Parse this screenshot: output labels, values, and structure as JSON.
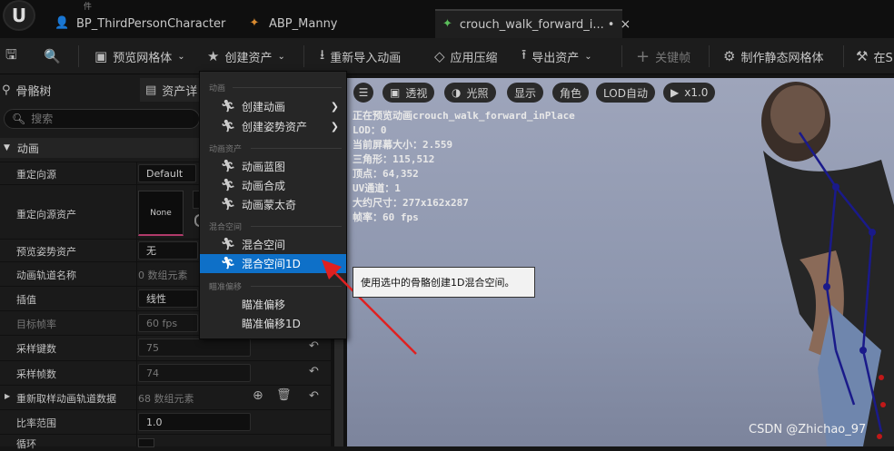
{
  "topmenu": [
    "件",
    "",
    "",
    ""
  ],
  "tabs": [
    {
      "label": "BP_ThirdPersonCharacter",
      "icon": "person-icon"
    },
    {
      "label": "ABP_Manny",
      "icon": "anim-blueprint-icon"
    },
    {
      "label": "crouch_walk_forward_i...",
      "icon": "anim-sequence-icon",
      "modified": "•",
      "close": "×"
    }
  ],
  "toolbar": {
    "preview_mesh": "预览网格体",
    "create_asset": "创建资产",
    "reimport": "重新导入动画",
    "apply_compression": "应用压缩",
    "export_asset": "导出资产",
    "keyframe": "关键帧",
    "make_static_mesh": "制作静态网格体",
    "more": "在S"
  },
  "panel": {
    "tab_skeleton": "骨骼树",
    "tab_asset": "资产详",
    "search_placeholder": "搜索",
    "section": "动画",
    "rows": {
      "retarget_source": {
        "label": "重定向源",
        "value": "Default"
      },
      "retarget_source_asset": {
        "label": "重定向源资产",
        "value": "None"
      },
      "preview_pose": {
        "label": "预览姿势资产",
        "value": "无"
      },
      "track_names": {
        "label": "动画轨道名称",
        "value": "0 数组元素"
      },
      "interpolation": {
        "label": "插值",
        "value": "线性"
      },
      "target_fps": {
        "label": "目标帧率",
        "value": "60 fps"
      },
      "sample_keys": {
        "label": "采样键数",
        "value": "75"
      },
      "sample_frames": {
        "label": "采样帧数",
        "value": "74"
      },
      "resample_tracks": {
        "label": "重新取样动画轨道数据",
        "value": "68 数组元素"
      },
      "rate_scale": {
        "label": "比率范围",
        "value": "1.0"
      },
      "loop": {
        "label": "循环"
      }
    }
  },
  "viewport": {
    "perspective": "透视",
    "lit": "光照",
    "show": "显示",
    "character": "角色",
    "lod": "LOD自动",
    "play_rate": "x1.0",
    "stats": [
      "正在预览动画crouch_walk_forward_inPlace",
      "LOD：0",
      "当前屏幕大小：2.559",
      "三角形：115,512",
      "顶点：64,352",
      "UV通道：1",
      "大约尺寸：277x162x287",
      "帧率：60 fps"
    ]
  },
  "menu": {
    "h_anim": "动画",
    "create_animation": "创建动画",
    "create_pose_asset": "创建姿势资产",
    "h_anim_assets": "动画资产",
    "anim_blueprint": "动画蓝图",
    "anim_composite": "动画合成",
    "anim_montage": "动画蒙太奇",
    "h_blend_space": "混合空间",
    "blend_space": "混合空间",
    "blend_space_1d": "混合空间1D",
    "h_aim_offset": "瞄准偏移",
    "aim_offset": "瞄准偏移",
    "aim_offset_1d": "瞄准偏移1D"
  },
  "tooltip": "使用选中的骨骼创建1D混合空间。",
  "watermark": "CSDN @Zhichao_97",
  "colors": {
    "highlight": "#0e70c8",
    "annotation_arrow": "#e02020"
  }
}
